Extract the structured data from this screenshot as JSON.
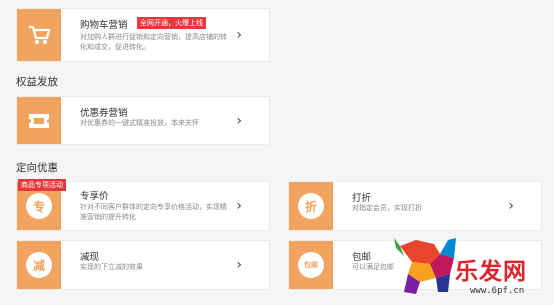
{
  "cards": {
    "cart_marketing": {
      "title": "购物车营销",
      "tag": "全网开通，火爆上线",
      "desc": "对加购人群进行促销和定向营销，提高店铺的转化和成交，促进转化。"
    },
    "coupon_marketing": {
      "title": "优惠券营销",
      "desc": "对优惠券的一键式精准投放，本来关怀"
    },
    "exclusive_price": {
      "title": "专享价",
      "tag": "商品专项活动",
      "desc": "针对不同客户群体的定向专享价格活动，实现精准营销的提升转化"
    },
    "discount": {
      "title": "打折",
      "desc": "对指定会员，实现打折"
    },
    "cash_reduction": {
      "title": "减现",
      "desc": "实现的下立减的效果"
    },
    "free_shipping": {
      "title": "包邮",
      "desc": "可以满足包邮"
    }
  },
  "sections": {
    "rights": "权益发放",
    "targeted": "定向优惠"
  },
  "icons": {
    "cart": "cart-icon",
    "coupon": "coupon-icon",
    "exclusive": "专",
    "discount": "折",
    "cash": "减",
    "shipping": "包邮"
  },
  "watermark": {
    "brand": "乐发网",
    "url": "www.6pf.cn"
  },
  "colors": {
    "accent": "#f0a460",
    "tag_red": "#e4393c",
    "brand_red": "#d9262c"
  }
}
